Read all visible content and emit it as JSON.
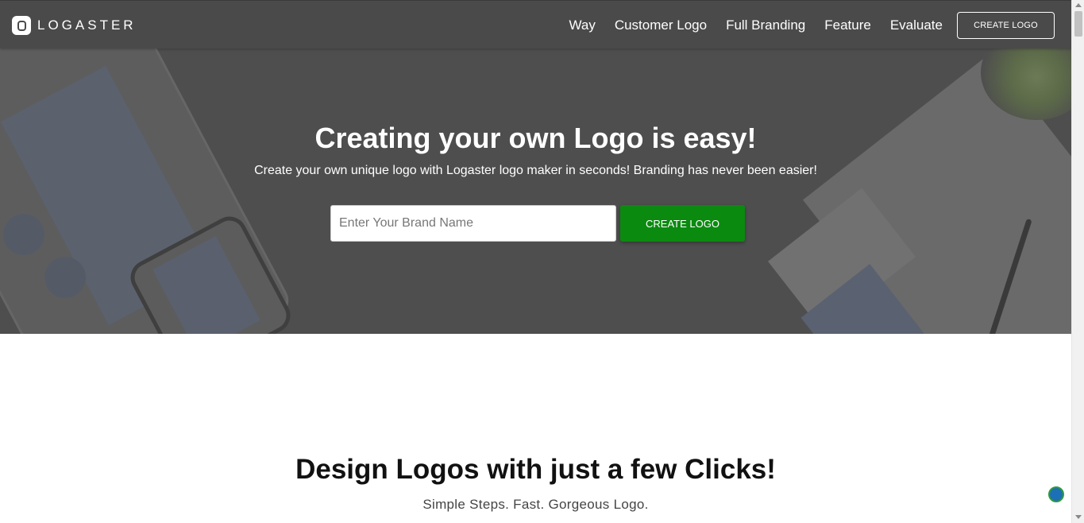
{
  "header": {
    "logo_text": "LOGASTER",
    "nav": [
      "Way",
      "Customer Logo",
      "Full Branding",
      "Feature",
      "Evaluate"
    ],
    "cta_label": "CREATE LOGO"
  },
  "hero": {
    "title": "Creating your own Logo is easy!",
    "subtitle": "Create your own unique logo with Logaster logo maker in seconds! Branding has never been easier!",
    "input_placeholder": "Enter Your Brand Name",
    "input_value": "",
    "cta_label": "CREATE LOGO"
  },
  "section": {
    "title": "Design Logos with just a few Clicks!",
    "subtitle": "Simple Steps. Fast. Gorgeous Logo."
  },
  "colors": {
    "header_bg": "#4a4a4a",
    "hero_bg": "#4e4e4e",
    "cta_green": "#0b8a10"
  },
  "icons": {
    "logo": "logaster-logo-icon",
    "badge": "globe-badge-icon"
  }
}
